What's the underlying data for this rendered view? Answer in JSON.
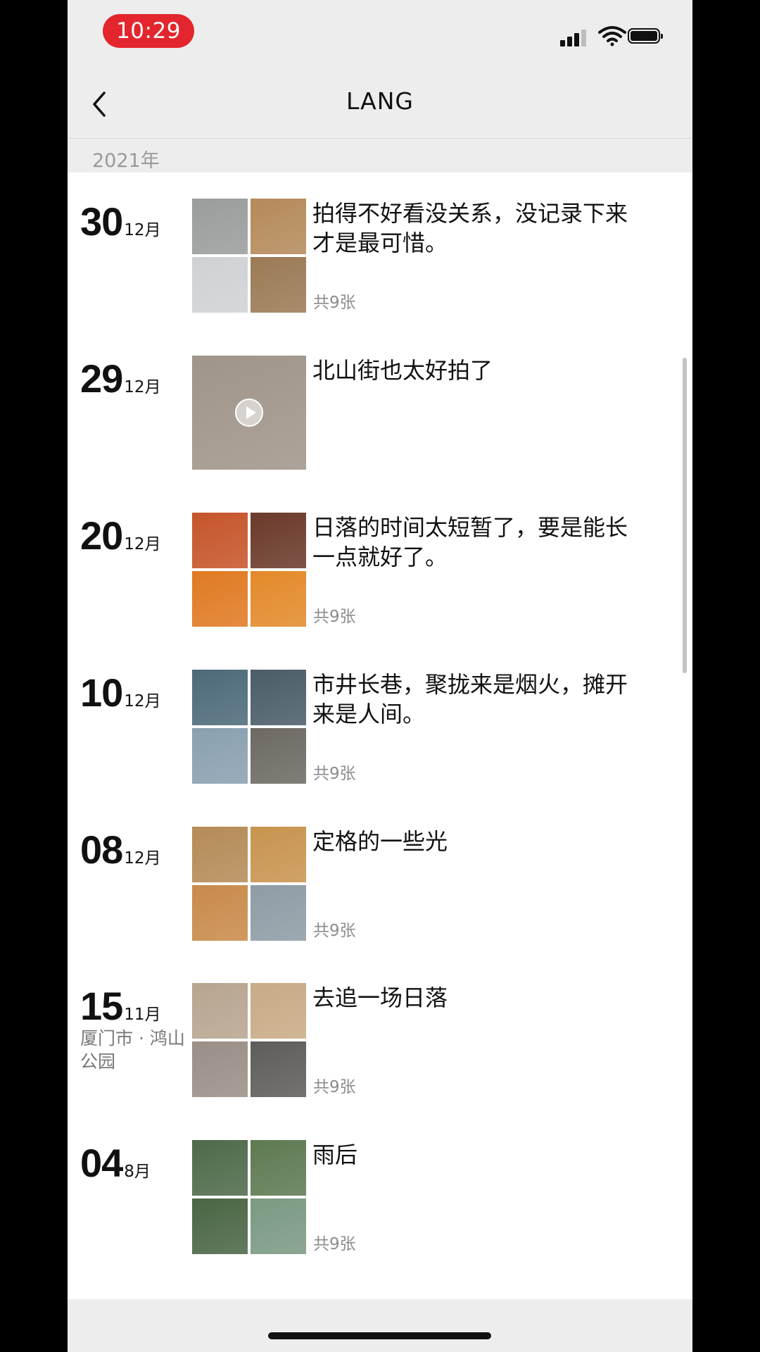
{
  "status_bar": {
    "time": "10:29",
    "signal_icon": "signal-bars-icon",
    "wifi_icon": "wifi-icon",
    "battery_icon": "battery-icon"
  },
  "nav": {
    "back_icon": "chevron-left-icon",
    "title": "LANG"
  },
  "year_header": "2021年",
  "entries": [
    {
      "day": "30",
      "month": "12月",
      "location": "",
      "caption": "拍得不好看没关系，没记录下来才是最可惜。",
      "count": "共9张",
      "layout": "grid4",
      "thumb_colors": [
        "#9a9d9c",
        "#b58a5a",
        "#cfd2d4",
        "#9b7a55"
      ]
    },
    {
      "day": "29",
      "month": "12月",
      "location": "",
      "caption": "北山街也太好拍了",
      "count": "",
      "layout": "single-video",
      "thumb_colors": [
        "#a0958a"
      ]
    },
    {
      "day": "20",
      "month": "12月",
      "location": "",
      "caption": "日落的时间太短暂了，要是能长一点就好了。",
      "count": "共9张",
      "layout": "grid4",
      "thumb_colors": [
        "#c6552a",
        "#6b3a2a",
        "#e07a22",
        "#e38a2a"
      ]
    },
    {
      "day": "10",
      "month": "12月",
      "location": "",
      "caption": "市井长巷，聚拢来是烟火，摊开来是人间。",
      "count": "共9张",
      "layout": "grid4",
      "thumb_colors": [
        "#4d6a7a",
        "#4a5d68",
        "#8aa0b0",
        "#6d6a62"
      ]
    },
    {
      "day": "08",
      "month": "12月",
      "location": "",
      "caption": "定格的一些光",
      "count": "共9张",
      "layout": "grid4",
      "thumb_colors": [
        "#b58b57",
        "#c8944f",
        "#c98a4a",
        "#8f9ca5"
      ]
    },
    {
      "day": "15",
      "month": "11月",
      "location": "厦门市 · 鸿山公园",
      "caption": "去追一场日落",
      "count": "共9张",
      "layout": "grid4",
      "thumb_colors": [
        "#b7a58f",
        "#c8ab86",
        "#9a8f86",
        "#5f5d59"
      ]
    },
    {
      "day": "04",
      "month": "8月",
      "location": "",
      "caption": "雨后",
      "count": "共9张",
      "layout": "grid4",
      "thumb_colors": [
        "#4e6a4a",
        "#5e7a52",
        "#4a6644",
        "#7a9a82"
      ]
    }
  ]
}
